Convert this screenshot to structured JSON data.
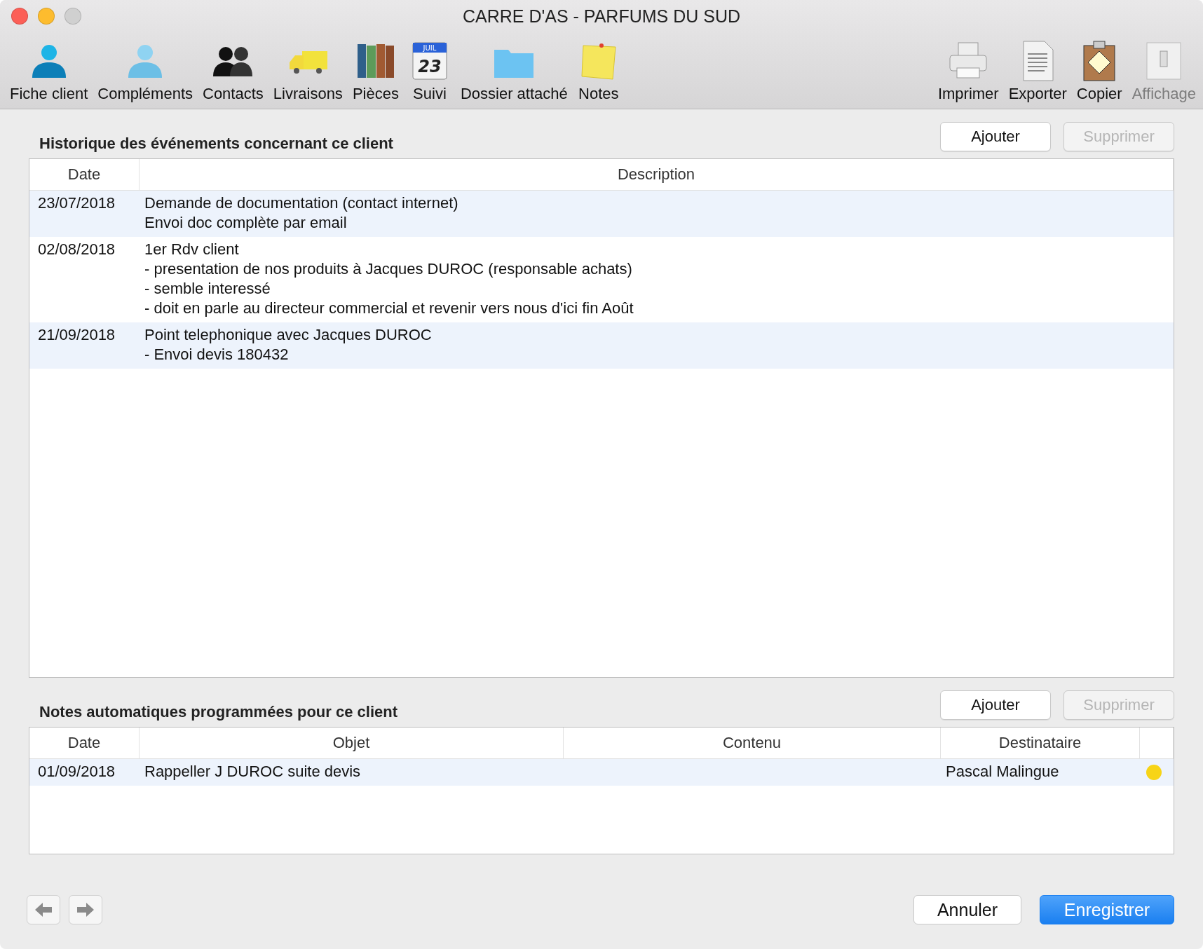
{
  "window": {
    "title": "CARRE D'AS - PARFUMS DU SUD"
  },
  "toolbar": {
    "left": [
      {
        "label": "Fiche client",
        "disabled": false
      },
      {
        "label": "Compléments",
        "disabled": false
      },
      {
        "label": "Contacts",
        "disabled": false
      },
      {
        "label": "Livraisons",
        "disabled": false
      },
      {
        "label": "Pièces",
        "disabled": false
      },
      {
        "label": "Suivi",
        "disabled": false,
        "calendar_month": "JUIL",
        "calendar_day": "23"
      },
      {
        "label": "Dossier attaché",
        "disabled": false
      },
      {
        "label": "Notes",
        "disabled": false
      }
    ],
    "right": [
      {
        "label": "Imprimer",
        "disabled": false
      },
      {
        "label": "Exporter",
        "disabled": false
      },
      {
        "label": "Copier",
        "disabled": false
      },
      {
        "label": "Affichage",
        "disabled": true
      }
    ]
  },
  "history": {
    "title": "Historique des événements concernant ce client",
    "buttons": [
      {
        "label": "Ajouter",
        "disabled": false
      },
      {
        "label": "Supprimer",
        "disabled": true
      }
    ],
    "columns": [
      "Date",
      "Description"
    ],
    "rows": [
      {
        "date": "23/07/2018",
        "lines": [
          "Demande de documentation (contact internet)",
          "Envoi doc complète par email"
        ]
      },
      {
        "date": "02/08/2018",
        "lines": [
          "1er Rdv client",
          "- presentation de nos produits à Jacques DUROC (responsable achats)",
          "- semble interessé",
          "- doit en parle au directeur commercial et revenir vers nous d'ici fin Août"
        ]
      },
      {
        "date": "21/09/2018",
        "lines": [
          "Point telephonique avec Jacques DUROC",
          "- Envoi devis 180432"
        ]
      }
    ]
  },
  "notes": {
    "title": "Notes automatiques programmées pour ce client",
    "buttons": [
      {
        "label": "Ajouter",
        "disabled": false
      },
      {
        "label": "Supprimer",
        "disabled": true
      }
    ],
    "columns": [
      "Date",
      "Objet",
      "Contenu",
      "Destinataire"
    ],
    "rows": [
      {
        "date": "01/09/2018",
        "objet": "Rappeller J DUROC suite devis",
        "destinataire": "Pascal Malingue",
        "color": "#f7d417"
      }
    ]
  },
  "footer": {
    "cancel": "Annuler",
    "save": "Enregistrer"
  }
}
